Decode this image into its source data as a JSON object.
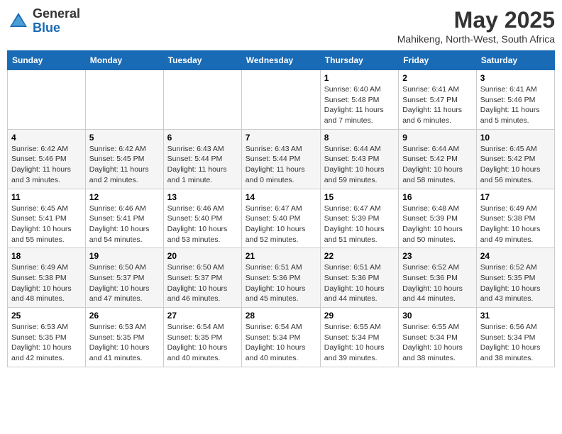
{
  "logo": {
    "general": "General",
    "blue": "Blue"
  },
  "title": {
    "month": "May 2025",
    "location": "Mahikeng, North-West, South Africa"
  },
  "weekdays": [
    "Sunday",
    "Monday",
    "Tuesday",
    "Wednesday",
    "Thursday",
    "Friday",
    "Saturday"
  ],
  "weeks": [
    [
      {
        "day": "",
        "info": ""
      },
      {
        "day": "",
        "info": ""
      },
      {
        "day": "",
        "info": ""
      },
      {
        "day": "",
        "info": ""
      },
      {
        "day": "1",
        "info": "Sunrise: 6:40 AM\nSunset: 5:48 PM\nDaylight: 11 hours and 7 minutes."
      },
      {
        "day": "2",
        "info": "Sunrise: 6:41 AM\nSunset: 5:47 PM\nDaylight: 11 hours and 6 minutes."
      },
      {
        "day": "3",
        "info": "Sunrise: 6:41 AM\nSunset: 5:46 PM\nDaylight: 11 hours and 5 minutes."
      }
    ],
    [
      {
        "day": "4",
        "info": "Sunrise: 6:42 AM\nSunset: 5:46 PM\nDaylight: 11 hours and 3 minutes."
      },
      {
        "day": "5",
        "info": "Sunrise: 6:42 AM\nSunset: 5:45 PM\nDaylight: 11 hours and 2 minutes."
      },
      {
        "day": "6",
        "info": "Sunrise: 6:43 AM\nSunset: 5:44 PM\nDaylight: 11 hours and 1 minute."
      },
      {
        "day": "7",
        "info": "Sunrise: 6:43 AM\nSunset: 5:44 PM\nDaylight: 11 hours and 0 minutes."
      },
      {
        "day": "8",
        "info": "Sunrise: 6:44 AM\nSunset: 5:43 PM\nDaylight: 10 hours and 59 minutes."
      },
      {
        "day": "9",
        "info": "Sunrise: 6:44 AM\nSunset: 5:42 PM\nDaylight: 10 hours and 58 minutes."
      },
      {
        "day": "10",
        "info": "Sunrise: 6:45 AM\nSunset: 5:42 PM\nDaylight: 10 hours and 56 minutes."
      }
    ],
    [
      {
        "day": "11",
        "info": "Sunrise: 6:45 AM\nSunset: 5:41 PM\nDaylight: 10 hours and 55 minutes."
      },
      {
        "day": "12",
        "info": "Sunrise: 6:46 AM\nSunset: 5:41 PM\nDaylight: 10 hours and 54 minutes."
      },
      {
        "day": "13",
        "info": "Sunrise: 6:46 AM\nSunset: 5:40 PM\nDaylight: 10 hours and 53 minutes."
      },
      {
        "day": "14",
        "info": "Sunrise: 6:47 AM\nSunset: 5:40 PM\nDaylight: 10 hours and 52 minutes."
      },
      {
        "day": "15",
        "info": "Sunrise: 6:47 AM\nSunset: 5:39 PM\nDaylight: 10 hours and 51 minutes."
      },
      {
        "day": "16",
        "info": "Sunrise: 6:48 AM\nSunset: 5:39 PM\nDaylight: 10 hours and 50 minutes."
      },
      {
        "day": "17",
        "info": "Sunrise: 6:49 AM\nSunset: 5:38 PM\nDaylight: 10 hours and 49 minutes."
      }
    ],
    [
      {
        "day": "18",
        "info": "Sunrise: 6:49 AM\nSunset: 5:38 PM\nDaylight: 10 hours and 48 minutes."
      },
      {
        "day": "19",
        "info": "Sunrise: 6:50 AM\nSunset: 5:37 PM\nDaylight: 10 hours and 47 minutes."
      },
      {
        "day": "20",
        "info": "Sunrise: 6:50 AM\nSunset: 5:37 PM\nDaylight: 10 hours and 46 minutes."
      },
      {
        "day": "21",
        "info": "Sunrise: 6:51 AM\nSunset: 5:36 PM\nDaylight: 10 hours and 45 minutes."
      },
      {
        "day": "22",
        "info": "Sunrise: 6:51 AM\nSunset: 5:36 PM\nDaylight: 10 hours and 44 minutes."
      },
      {
        "day": "23",
        "info": "Sunrise: 6:52 AM\nSunset: 5:36 PM\nDaylight: 10 hours and 44 minutes."
      },
      {
        "day": "24",
        "info": "Sunrise: 6:52 AM\nSunset: 5:35 PM\nDaylight: 10 hours and 43 minutes."
      }
    ],
    [
      {
        "day": "25",
        "info": "Sunrise: 6:53 AM\nSunset: 5:35 PM\nDaylight: 10 hours and 42 minutes."
      },
      {
        "day": "26",
        "info": "Sunrise: 6:53 AM\nSunset: 5:35 PM\nDaylight: 10 hours and 41 minutes."
      },
      {
        "day": "27",
        "info": "Sunrise: 6:54 AM\nSunset: 5:35 PM\nDaylight: 10 hours and 40 minutes."
      },
      {
        "day": "28",
        "info": "Sunrise: 6:54 AM\nSunset: 5:34 PM\nDaylight: 10 hours and 40 minutes."
      },
      {
        "day": "29",
        "info": "Sunrise: 6:55 AM\nSunset: 5:34 PM\nDaylight: 10 hours and 39 minutes."
      },
      {
        "day": "30",
        "info": "Sunrise: 6:55 AM\nSunset: 5:34 PM\nDaylight: 10 hours and 38 minutes."
      },
      {
        "day": "31",
        "info": "Sunrise: 6:56 AM\nSunset: 5:34 PM\nDaylight: 10 hours and 38 minutes."
      }
    ]
  ]
}
